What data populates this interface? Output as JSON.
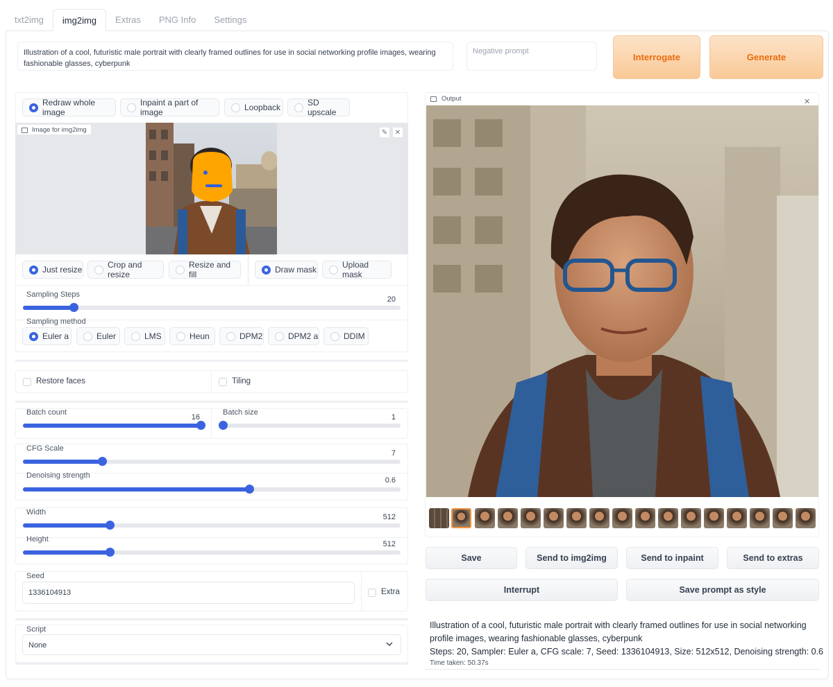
{
  "tabs": [
    "txt2img",
    "img2img",
    "Extras",
    "PNG Info",
    "Settings"
  ],
  "prompt": "Illustration of a cool, futuristic male portrait with clearly framed outlines for use in social networking profile images, wearing fashionable glasses, cyberpunk",
  "negative_placeholder": "Negative prompt",
  "buttons": {
    "interrogate": "Interrogate",
    "generate": "Generate"
  },
  "mode": {
    "options": [
      "Redraw whole image",
      "Inpaint a part of image",
      "Loopback",
      "SD upscale"
    ],
    "selected": "Redraw whole image"
  },
  "image_label": "Image for img2img",
  "resize": {
    "options": [
      "Just resize",
      "Crop and resize",
      "Resize and fill"
    ],
    "selected": "Just resize"
  },
  "mask": {
    "options": [
      "Draw mask",
      "Upload mask"
    ],
    "selected": "Draw mask"
  },
  "sampling_steps": {
    "label": "Sampling Steps",
    "value": "20",
    "fraction": 0.135
  },
  "sampling_method": {
    "label": "Sampling method",
    "options": [
      "Euler a",
      "Euler",
      "LMS",
      "Heun",
      "DPM2",
      "DPM2 a",
      "DDIM"
    ],
    "selected": "Euler a"
  },
  "restore_faces": "Restore faces",
  "tiling": "Tiling",
  "batch_count": {
    "label": "Batch count",
    "value": "16",
    "fraction": 1.0
  },
  "batch_size": {
    "label": "Batch size",
    "value": "1",
    "fraction": 0.0
  },
  "cfg": {
    "label": "CFG Scale",
    "value": "7",
    "fraction": 0.21
  },
  "denoise": {
    "label": "Denoising strength",
    "value": "0.6",
    "fraction": 0.6
  },
  "width": {
    "label": "Width",
    "value": "512",
    "fraction": 0.23
  },
  "height": {
    "label": "Height",
    "value": "512",
    "fraction": 0.23
  },
  "seed": {
    "label": "Seed",
    "value": "1336104913",
    "extra": "Extra"
  },
  "script": {
    "label": "Script",
    "value": "None"
  },
  "output_label": "Output",
  "actions": {
    "save": "Save",
    "send_img2img": "Send to img2img",
    "send_inpaint": "Send to inpaint",
    "send_extras": "Send to extras",
    "interrupt": "Interrupt",
    "save_style": "Save prompt as style"
  },
  "info": {
    "prompt": "Illustration of a cool, futuristic male portrait with clearly framed outlines for use in social networking profile images, wearing fashionable glasses, cyberpunk",
    "params": "Steps: 20, Sampler: Euler a, CFG scale: 7, Seed: 1336104913, Size: 512x512, Denoising strength: 0.6",
    "time": "Time taken: 50.37s"
  },
  "colors": {
    "accent": "#3b63e0",
    "generate_text": "#ea6b0e",
    "mask_face": "#ffa500"
  }
}
